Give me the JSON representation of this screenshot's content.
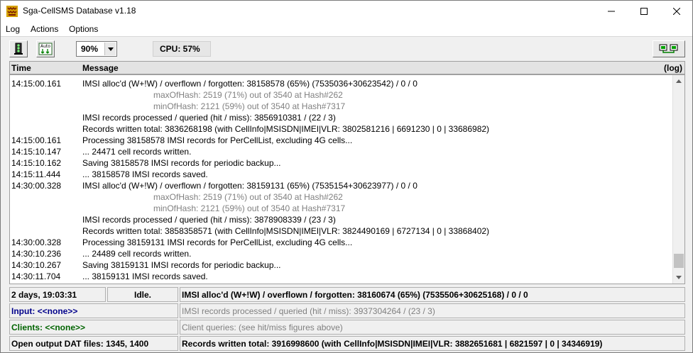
{
  "window": {
    "title": "Sga-CellSMS Database  v1.18"
  },
  "menu": [
    "Log",
    "Actions",
    "Options"
  ],
  "toolbar": {
    "zoom_value": "90%",
    "cpu_label": "CPU: 57%"
  },
  "log": {
    "col_time": "Time",
    "col_message": "Message",
    "col_log": "(log)",
    "rows": [
      {
        "time": "14:15:00.161",
        "msg": "IMSI alloc'd (W+!W) / overflown / forgotten: 38158578 (65%) (7535036+30623542) / 0 / 0",
        "indent": false
      },
      {
        "time": "",
        "msg": "maxOfHash: 2519 (71%) out of 3540 at Hash#262",
        "indent": true
      },
      {
        "time": "",
        "msg": "minOfHash: 2121 (59%) out of 3540 at Hash#7317",
        "indent": true
      },
      {
        "time": "",
        "msg": "IMSI records processed / queried (hit / miss): 3856910381 / (22 / 3)",
        "indent": false
      },
      {
        "time": "",
        "msg": "Records written total: 3836268198  (with CellInfo|MSISDN|IMEI|VLR: 3802581216 | 6691230 | 0 | 33686982)",
        "indent": false
      },
      {
        "time": "14:15:00.161",
        "msg": "Processing 38158578 IMSI records for PerCellList, excluding 4G cells...",
        "indent": false
      },
      {
        "time": "14:15:10.147",
        "msg": "... 24471 cell records written.",
        "indent": false
      },
      {
        "time": "14:15:10.162",
        "msg": "Saving 38158578 IMSI records for periodic backup...",
        "indent": false
      },
      {
        "time": "14:15:11.444",
        "msg": "... 38158578 IMSI records saved.",
        "indent": false
      },
      {
        "time": "14:30:00.328",
        "msg": "IMSI alloc'd (W+!W) / overflown / forgotten: 38159131 (65%) (7535154+30623977) / 0 / 0",
        "indent": false
      },
      {
        "time": "",
        "msg": "maxOfHash: 2519 (71%) out of 3540 at Hash#262",
        "indent": true
      },
      {
        "time": "",
        "msg": "minOfHash: 2121 (59%) out of 3540 at Hash#7317",
        "indent": true
      },
      {
        "time": "",
        "msg": "IMSI records processed / queried (hit / miss): 3878908339 / (23 / 3)",
        "indent": false
      },
      {
        "time": "",
        "msg": "Records written total: 3858358571  (with CellInfo|MSISDN|IMEI|VLR: 3824490169 | 6727134 | 0 | 33868402)",
        "indent": false
      },
      {
        "time": "14:30:00.328",
        "msg": "Processing 38159131 IMSI records for PerCellList, excluding 4G cells...",
        "indent": false
      },
      {
        "time": "14:30:10.236",
        "msg": "... 24489 cell records written.",
        "indent": false
      },
      {
        "time": "14:30:10.267",
        "msg": "Saving 38159131 IMSI records for periodic backup...",
        "indent": false
      },
      {
        "time": "14:30:11.704",
        "msg": "... 38159131 IMSI records saved.",
        "indent": false
      }
    ]
  },
  "status": {
    "uptime": "2 days, 19:03:31",
    "state": "Idle.",
    "alloc": "IMSI alloc'd (W+!W) / overflown / forgotten: 38160674 (65%) (7535506+30625168) / 0 / 0",
    "input": "Input: <<none>>",
    "processed": "IMSI records processed / queried (hit / miss): 3937304264 / (23 / 3)",
    "clients": "Clients: <<none>>",
    "client_queries": "Client queries:  (see hit/miss figures above)",
    "open_files": "Open output DAT files: 1345, 1400",
    "records_written": "Records written total: 3916998600  (with CellInfo|MSISDN|IMEI|VLR: 3882651681 | 6821597 | 0 | 34346919)"
  },
  "icons": {
    "app": "app-icon",
    "tool1": "traffic-light-icon",
    "tool2": "auto-icon",
    "network": "network-icon"
  },
  "colors": {
    "input_text": "#00008b",
    "clients_text": "#006400"
  }
}
